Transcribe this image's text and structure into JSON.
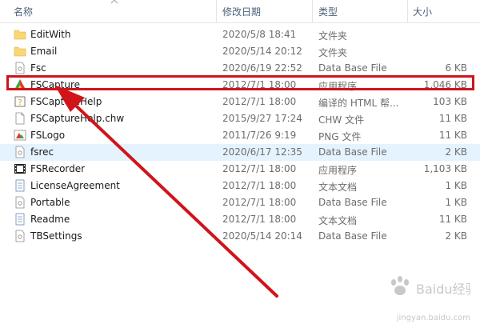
{
  "columns": {
    "name": "名称",
    "date": "修改日期",
    "type": "类型",
    "size": "大小"
  },
  "files": [
    {
      "name": "EditWith",
      "date": "2020/5/8 18:41",
      "type": "文件夹",
      "size": "",
      "icon": "folder-icon"
    },
    {
      "name": "Email",
      "date": "2020/5/14 20:12",
      "type": "文件夹",
      "size": "",
      "icon": "folder-icon"
    },
    {
      "name": "Fsc",
      "date": "2020/6/19 22:52",
      "type": "Data Base File",
      "size": "6 KB",
      "icon": "file-icon"
    },
    {
      "name": "FSCapture",
      "date": "2012/7/1 18:00",
      "type": "应用程序",
      "size": "1,046 KB",
      "icon": "fscapture-app-icon"
    },
    {
      "name": "FSCaptureHelp",
      "date": "2012/7/1 18:00",
      "type": "编译的 HTML 帮...",
      "size": "103 KB",
      "icon": "help-file-icon"
    },
    {
      "name": "FSCaptureHelp.chw",
      "date": "2015/9/27 17:24",
      "type": "CHW 文件",
      "size": "11 KB",
      "icon": "blank-file-icon"
    },
    {
      "name": "FSLogo",
      "date": "2011/7/26 9:19",
      "type": "PNG 文件",
      "size": "11 KB",
      "icon": "image-file-icon"
    },
    {
      "name": "fsrec",
      "date": "2020/6/17 12:35",
      "type": "Data Base File",
      "size": "2 KB",
      "icon": "file-icon"
    },
    {
      "name": "FSRecorder",
      "date": "2012/7/1 18:00",
      "type": "应用程序",
      "size": "1,103 KB",
      "icon": "film-app-icon"
    },
    {
      "name": "LicenseAgreement",
      "date": "2012/7/1 18:00",
      "type": "文本文档",
      "size": "1 KB",
      "icon": "text-file-icon"
    },
    {
      "name": "Portable",
      "date": "2012/7/1 18:00",
      "type": "Data Base File",
      "size": "1 KB",
      "icon": "file-icon"
    },
    {
      "name": "Readme",
      "date": "2012/7/1 18:00",
      "type": "文本文档",
      "size": "11 KB",
      "icon": "text-file-icon"
    },
    {
      "name": "TBSettings",
      "date": "2020/5/14 20:14",
      "type": "Data Base File",
      "size": "2 KB",
      "icon": "file-icon"
    }
  ],
  "watermark": {
    "brand": "Baidu经验",
    "url": "jingyan.baidu.com"
  },
  "colors": {
    "highlight": "#d0141a",
    "hover_row": "#e5f3ff",
    "header_text": "#4c607a"
  }
}
